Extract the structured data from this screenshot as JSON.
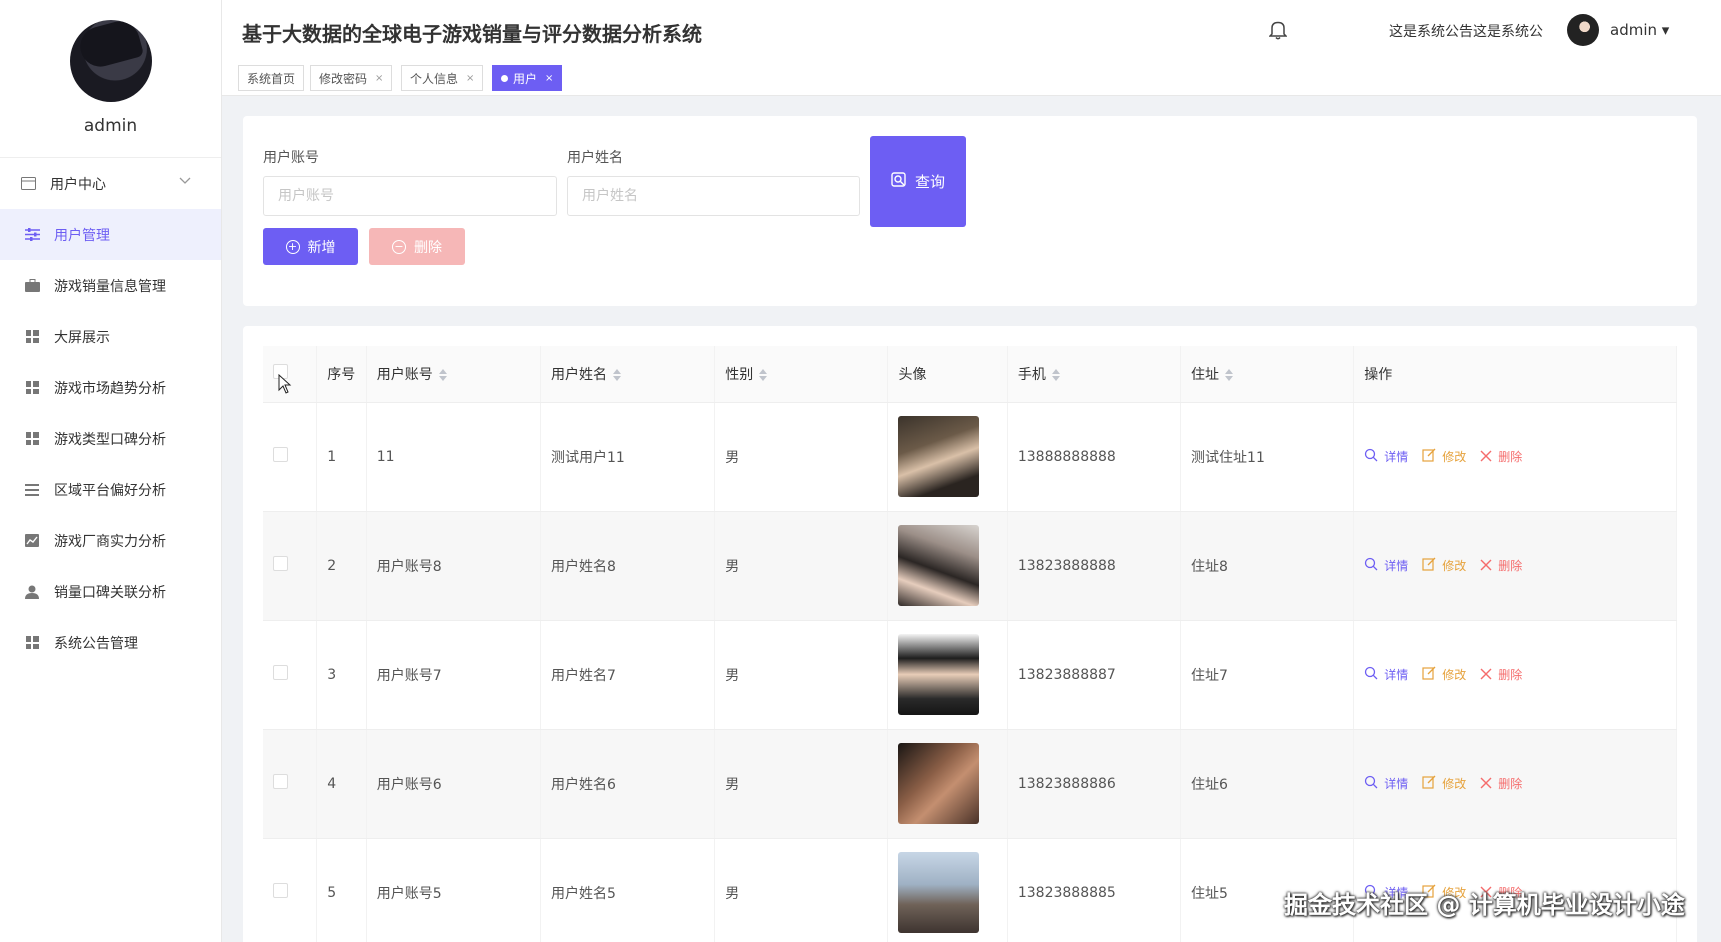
{
  "sidebar": {
    "username": "admin",
    "menu": [
      {
        "label": "用户中心",
        "icon": "card-icon"
      },
      {
        "label": "用户管理",
        "icon": "sliders-icon"
      },
      {
        "label": "游戏销量信息管理",
        "icon": "briefcase-icon"
      },
      {
        "label": "大屏展示",
        "icon": "grid-icon"
      },
      {
        "label": "游戏市场趋势分析",
        "icon": "grid-icon"
      },
      {
        "label": "游戏类型口碑分析",
        "icon": "grid-icon"
      },
      {
        "label": "区域平台偏好分析",
        "icon": "list-icon"
      },
      {
        "label": "游戏厂商实力分析",
        "icon": "chart-icon"
      },
      {
        "label": "销量口碑关联分析",
        "icon": "person-icon"
      },
      {
        "label": "系统公告管理",
        "icon": "grid-icon"
      }
    ]
  },
  "header": {
    "title": "基于大数据的全球电子游戏销量与评分数据分析系统",
    "notice": "这是系统公告这是系统公",
    "user": "admin ▾"
  },
  "tabs": [
    {
      "label": "系统首页",
      "closable": ""
    },
    {
      "label": "修改密码",
      "closable": "×"
    },
    {
      "label": "个人信息",
      "closable": "×"
    },
    {
      "label": "用户",
      "closable": "×"
    }
  ],
  "search": {
    "account_label": "用户账号",
    "account_placeholder": "用户账号",
    "name_label": "用户姓名",
    "name_placeholder": "用户姓名",
    "query_button": "查询",
    "add_button": "新增",
    "delete_button": "删除"
  },
  "table": {
    "headers": {
      "index": "序号",
      "account": "用户账号",
      "name": "用户姓名",
      "gender": "性别",
      "avatar": "头像",
      "phone": "手机",
      "address": "住址",
      "actions": "操作"
    },
    "actions": {
      "detail": "详情",
      "edit": "修改",
      "delete": "删除"
    },
    "rows": [
      {
        "index": "1",
        "account": "11",
        "name": "测试用户11",
        "gender": "男",
        "phone": "13888888888",
        "address": "测试住址11"
      },
      {
        "index": "2",
        "account": "用户账号8",
        "name": "用户姓名8",
        "gender": "男",
        "phone": "13823888888",
        "address": "住址8"
      },
      {
        "index": "3",
        "account": "用户账号7",
        "name": "用户姓名7",
        "gender": "男",
        "phone": "13823888887",
        "address": "住址7"
      },
      {
        "index": "4",
        "account": "用户账号6",
        "name": "用户姓名6",
        "gender": "男",
        "phone": "13823888886",
        "address": "住址6"
      },
      {
        "index": "5",
        "account": "用户账号5",
        "name": "用户姓名5",
        "gender": "男",
        "phone": "13823888885",
        "address": "住址5"
      }
    ]
  },
  "watermark": "掘金技术社区 @ 计算机毕业设计小途",
  "colors": {
    "accent": "#6d5ef3",
    "danger_light": "#f6b7b7",
    "edit": "#e6a23c",
    "delete": "#f56c6c"
  }
}
